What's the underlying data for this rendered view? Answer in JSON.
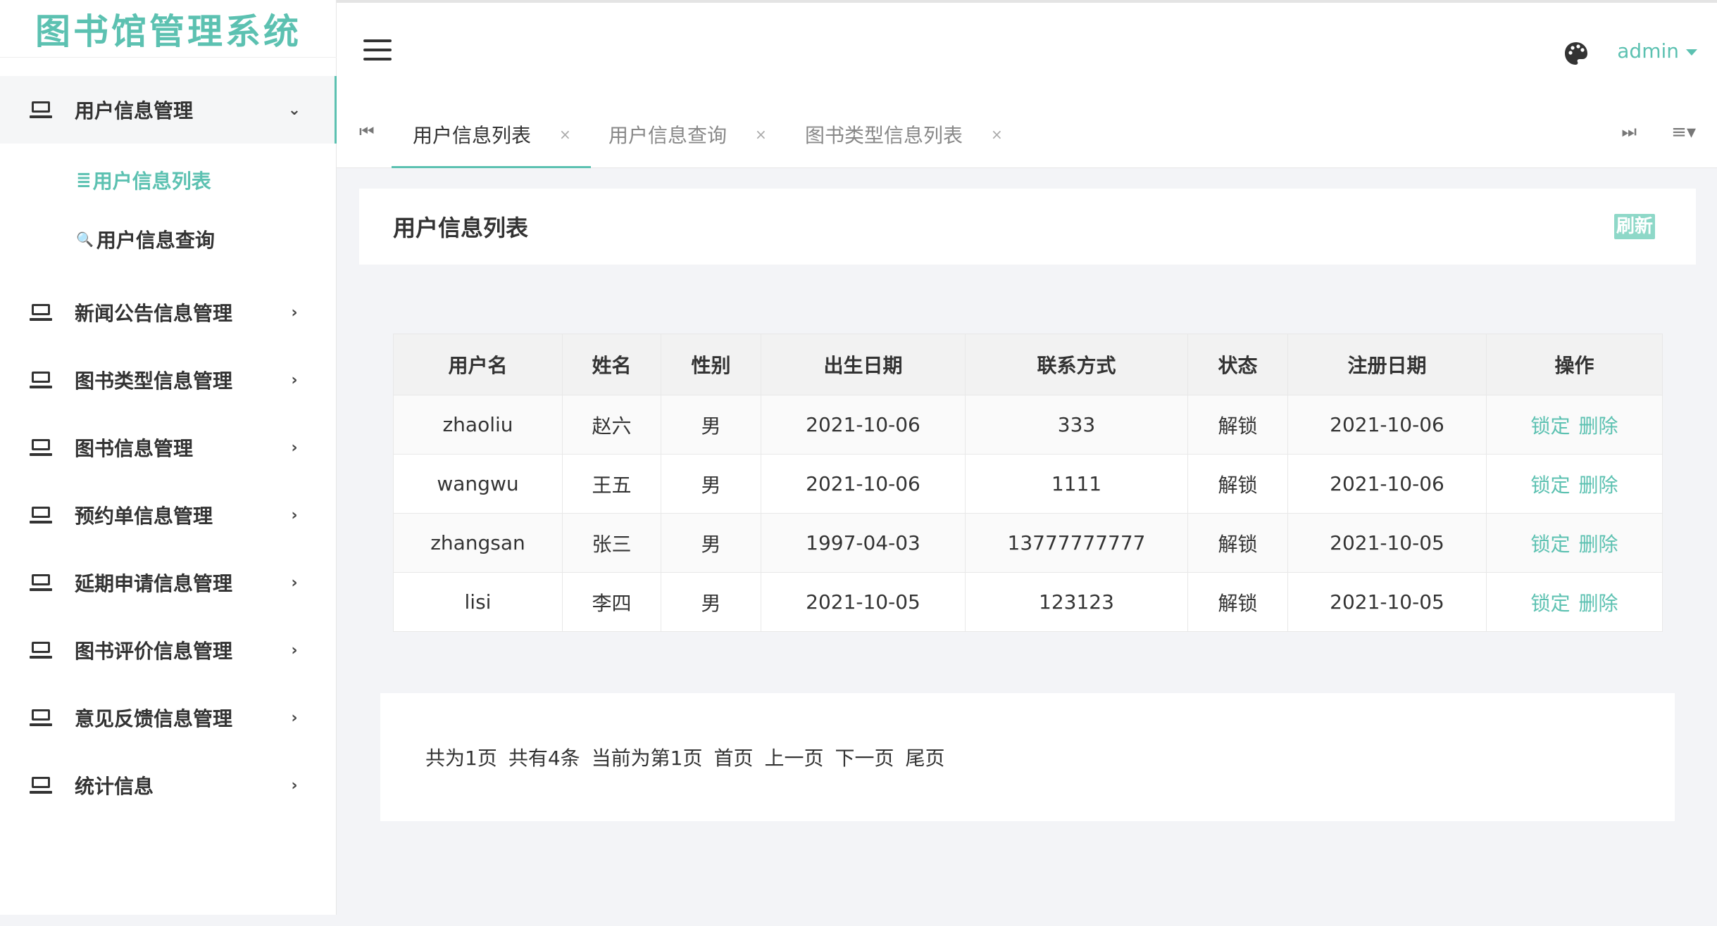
{
  "app": {
    "title": "图书馆管理系统"
  },
  "sidebar": {
    "active_group": {
      "label": "用户信息管理",
      "icon": "laptop-icon"
    },
    "sub_items": [
      {
        "icon": "≣",
        "label": "用户信息列表"
      },
      {
        "icon": "🔍",
        "label": "用户信息查询"
      }
    ],
    "groups": [
      {
        "label": "新闻公告信息管理"
      },
      {
        "label": "图书类型信息管理"
      },
      {
        "label": "图书信息管理"
      },
      {
        "label": "预约单信息管理"
      },
      {
        "label": "延期申请信息管理"
      },
      {
        "label": "图书评价信息管理"
      },
      {
        "label": "意见反馈信息管理"
      },
      {
        "label": "统计信息"
      }
    ]
  },
  "header": {
    "user": "admin",
    "icons": [
      "hamburger-icon",
      "palette-icon"
    ]
  },
  "tabs": [
    {
      "label": "用户信息列表",
      "close": "×"
    },
    {
      "label": "用户信息查询",
      "close": "×"
    },
    {
      "label": "图书类型信息列表",
      "close": "×"
    }
  ],
  "tab_nav": {
    "prev": "⏮",
    "next": "⏭",
    "menu": "≡▾"
  },
  "panel": {
    "title": "用户信息列表",
    "refresh": "刷新"
  },
  "table": {
    "columns": [
      "用户名",
      "姓名",
      "性别",
      "出生日期",
      "联系方式",
      "状态",
      "注册日期",
      "操作"
    ],
    "rows": [
      {
        "username": "zhaoliu",
        "name": "赵六",
        "gender": "男",
        "birth": "2021-10-06",
        "contact": "333",
        "status": "解锁",
        "reg": "2021-10-06",
        "lock": "锁定",
        "delete": "删除"
      },
      {
        "username": "wangwu",
        "name": "王五",
        "gender": "男",
        "birth": "2021-10-06",
        "contact": "1111",
        "status": "解锁",
        "reg": "2021-10-06",
        "lock": "锁定",
        "delete": "删除"
      },
      {
        "username": "zhangsan",
        "name": "张三",
        "gender": "男",
        "birth": "1997-04-03",
        "contact": "13777777777",
        "status": "解锁",
        "reg": "2021-10-05",
        "lock": "锁定",
        "delete": "删除"
      },
      {
        "username": "lisi",
        "name": "李四",
        "gender": "男",
        "birth": "2021-10-05",
        "contact": "123123",
        "status": "解锁",
        "reg": "2021-10-05",
        "lock": "锁定",
        "delete": "删除"
      }
    ]
  },
  "pager": {
    "total_pages": "共为1页",
    "total_records": "共有4条",
    "current": "当前为第1页",
    "first": "首页",
    "prev": "上一页",
    "next": "下一页",
    "last": "尾页"
  },
  "colors": {
    "accent": "#5cc1b1",
    "background": "#f3f4f7"
  }
}
